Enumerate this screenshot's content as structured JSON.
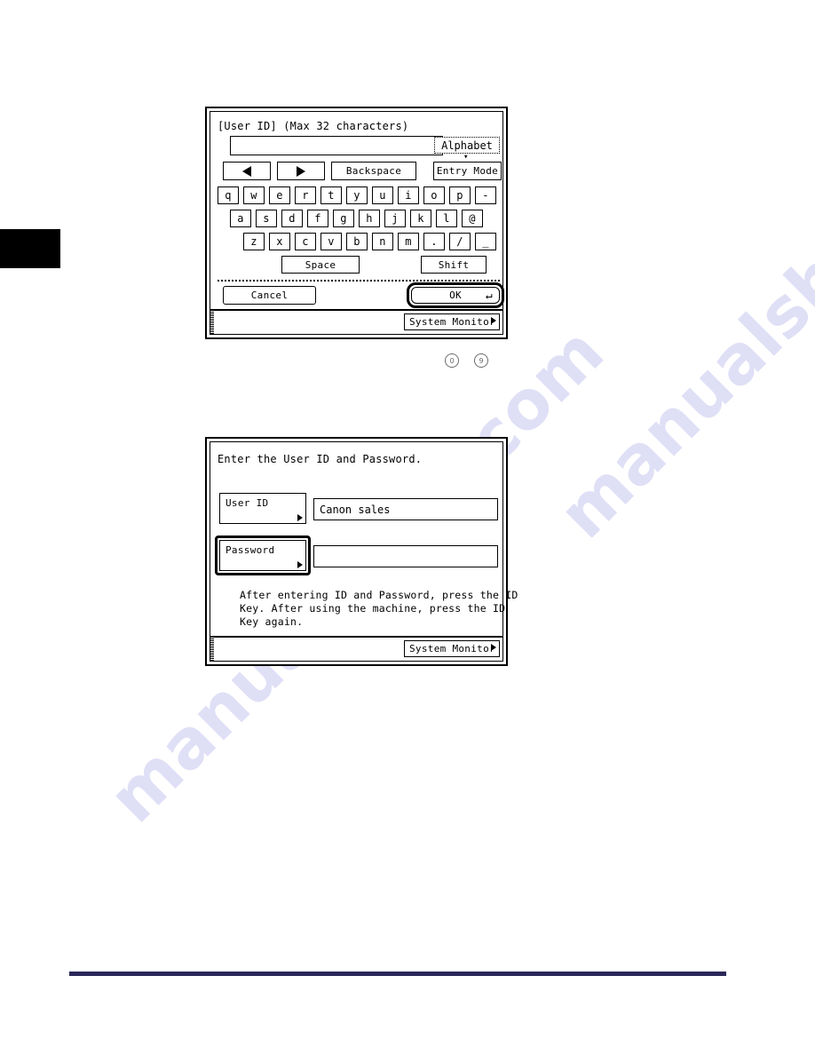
{
  "page": {
    "watermark": "manualshive.com",
    "footer_rule_color": "#2a2759",
    "chapter_tab_color": "#000000"
  },
  "step_markers": [
    {
      "label": "0"
    },
    {
      "label": "9"
    }
  ],
  "panel_keyboard": {
    "title": "[User ID] (Max 32 characters)",
    "input_value": "",
    "mode_tab": {
      "label": "Alphabet",
      "chevron": "chevron-down"
    },
    "nav": {
      "left_arrow": "◀",
      "right_arrow": "▶",
      "backspace": "Backspace",
      "entry_mode": "Entry Mode"
    },
    "rows": [
      [
        "q",
        "w",
        "e",
        "r",
        "t",
        "y",
        "u",
        "i",
        "o",
        "p",
        "-"
      ],
      [
        "a",
        "s",
        "d",
        "f",
        "g",
        "h",
        "j",
        "k",
        "l",
        "@"
      ],
      [
        "z",
        "x",
        "c",
        "v",
        "b",
        "n",
        "m",
        ".",
        "/",
        "_"
      ]
    ],
    "space_label": "Space",
    "shift_label": "Shift",
    "cancel_label": "Cancel",
    "ok_label": "OK",
    "ok_enter_glyph": "↵",
    "status_bar": {
      "system_monitor": "System Monitor"
    }
  },
  "panel_login": {
    "prompt": "Enter the User ID and Password.",
    "user_id": {
      "button_label": "User ID",
      "value": "Canon sales"
    },
    "password": {
      "button_label": "Password",
      "value": ""
    },
    "instructions": [
      "After entering ID and Password, press the ID",
      "Key. After using the machine, press the ID",
      "Key again."
    ],
    "status_bar": {
      "system_monitor": "System Monitor"
    }
  }
}
